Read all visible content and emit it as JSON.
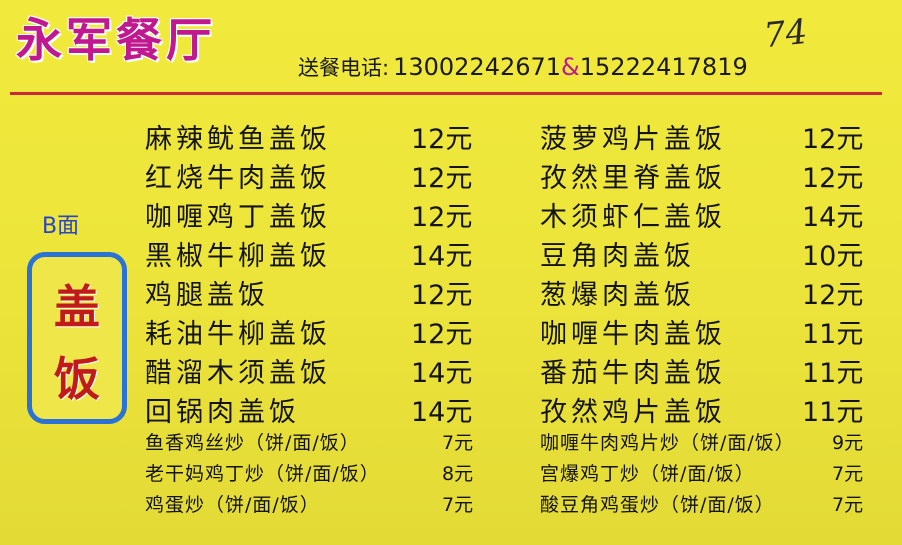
{
  "brand": "永军餐厅",
  "phone_label": "送餐电话:",
  "phone_1": "13002242671",
  "phone_sep": "&",
  "phone_2": "15222417819",
  "handwritten_note": "74",
  "side_tag": "B面",
  "badge_chars": [
    "盖",
    "饭"
  ],
  "left_items": [
    {
      "name": "麻辣鱿鱼盖饭",
      "price": "12元"
    },
    {
      "name": "红烧牛肉盖饭",
      "price": "12元"
    },
    {
      "name": "咖喱鸡丁盖饭",
      "price": "12元"
    },
    {
      "name": "黑椒牛柳盖饭",
      "price": "14元"
    },
    {
      "name": "鸡腿盖饭",
      "price": "12元"
    },
    {
      "name": "耗油牛柳盖饭",
      "price": "12元"
    },
    {
      "name": "醋溜木须盖饭",
      "price": "14元"
    },
    {
      "name": "回锅肉盖饭",
      "price": "14元"
    }
  ],
  "right_items": [
    {
      "name": "菠萝鸡片盖饭",
      "price": "12元"
    },
    {
      "name": "孜然里脊盖饭",
      "price": "12元"
    },
    {
      "name": "木须虾仁盖饭",
      "price": "14元"
    },
    {
      "name": "豆角肉盖饭",
      "price": "10元"
    },
    {
      "name": "葱爆肉盖饭",
      "price": "12元"
    },
    {
      "name": "咖喱牛肉盖饭",
      "price": "11元"
    },
    {
      "name": "番茄牛肉盖饭",
      "price": "11元"
    },
    {
      "name": "孜然鸡片盖饭",
      "price": "11元"
    }
  ],
  "left_small": [
    {
      "name": "鱼香鸡丝炒（饼/面/饭）",
      "price": "7元"
    },
    {
      "name": "老干妈鸡丁炒（饼/面/饭）",
      "price": "8元"
    },
    {
      "name": "鸡蛋炒（饼/面/饭）",
      "price": "7元"
    }
  ],
  "right_small": [
    {
      "name": "咖喱牛肉鸡片炒（饼/面/饭）",
      "price": "9元"
    },
    {
      "name": "宫爆鸡丁炒（饼/面/饭）",
      "price": "7元"
    },
    {
      "name": "酸豆角鸡蛋炒（饼/面/饭）",
      "price": "7元"
    }
  ],
  "colors": {
    "background": "#ece43a",
    "brand": "#c0188f",
    "rule": "#c82a3a",
    "badge_border": "#2a72d6",
    "badge_text": "#c01a1a"
  }
}
